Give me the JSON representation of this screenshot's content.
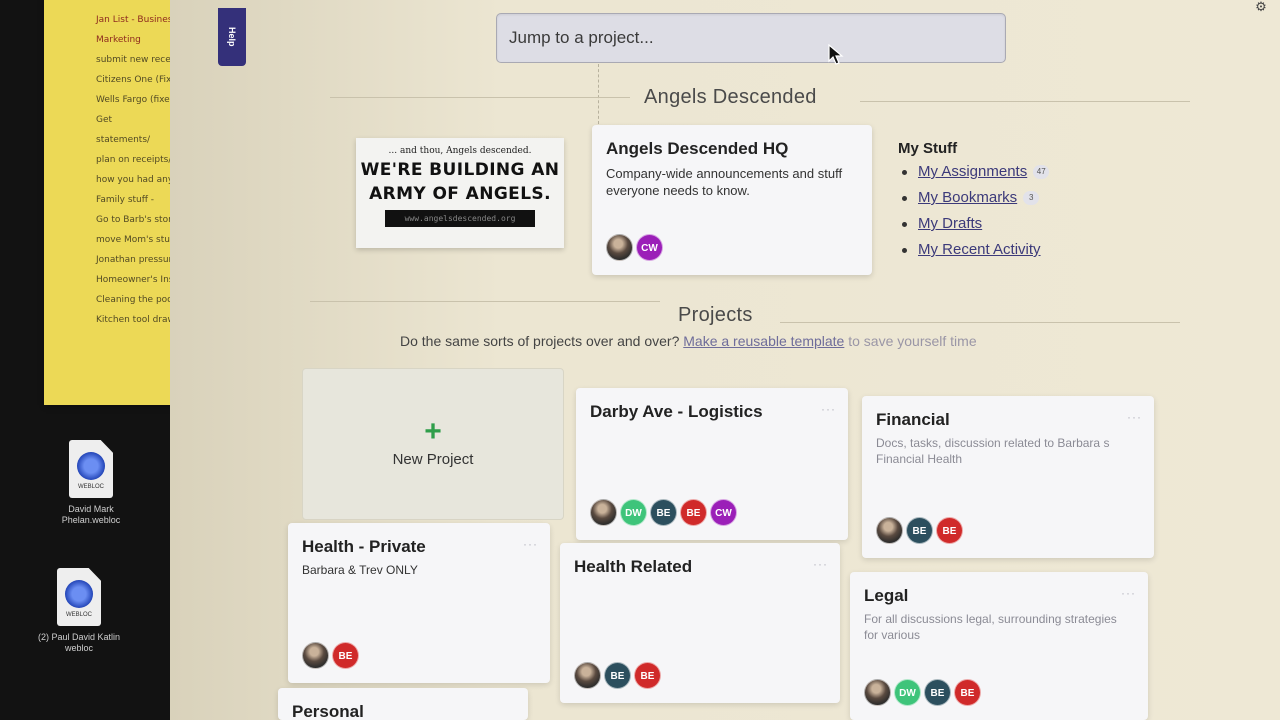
{
  "desktop": {
    "sticky_note_lines": [
      "Jan List - Business",
      "Marketing",
      "submit new receipts",
      "Citizens One (Fixed)",
      "Wells Fargo (fixed cost)",
      "Get",
      "statements/",
      "plan on receipts/fees",
      "how you had any ...",
      "Family stuff -",
      "Go to Barb's storage",
      "move Mom's stuff to st...",
      "Jonathan pressure ...",
      "Homeowner's Insurance",
      "Cleaning the pool",
      "Kitchen tool drawer"
    ],
    "icons": [
      {
        "label": "David Mark Phelan.webloc",
        "ext": "WEBLOC"
      },
      {
        "label": "(2) Paul David Katlin webloc",
        "ext": "WEBLOC"
      }
    ]
  },
  "app": {
    "help_label": "Help",
    "jump_placeholder": "Jump to a project...",
    "company_title": "Angels Descended",
    "poster": {
      "tagline": "... and thou, Angels descended.",
      "headline_1": "WE'RE BUILDING AN",
      "headline_2": "ARMY OF ANGELS.",
      "url": "www.angelsdescended.org"
    },
    "hq": {
      "title": "Angels Descended HQ",
      "description": "Company-wide announcements and stuff everyone needs to know.",
      "avatars": [
        {
          "initials": "",
          "color": "photo"
        },
        {
          "initials": "CW",
          "color": "#9b1fb8"
        }
      ]
    },
    "my_stuff": {
      "heading": "My Stuff",
      "links": [
        {
          "label": "My Assignments",
          "badge": "47"
        },
        {
          "label": "My Bookmarks",
          "badge": "3"
        },
        {
          "label": "My Drafts",
          "badge": ""
        },
        {
          "label": "My Recent Activity",
          "badge": ""
        }
      ]
    },
    "projects_title": "Projects",
    "projects_prompt": "Do the same sorts of projects over and over?",
    "projects_link": "Make a reusable template",
    "projects_suffix": " to save yourself time",
    "new_project_label": "New Project",
    "projects": [
      {
        "title": "Darby Ave - Logistics",
        "description": "",
        "avatars": [
          {
            "initials": "",
            "color": "photo"
          },
          {
            "initials": "DW",
            "color": "#3ec47a"
          },
          {
            "initials": "BE",
            "color": "#2c4f5e"
          },
          {
            "initials": "BE",
            "color": "#d02a2a"
          },
          {
            "initials": "CW",
            "color": "#9b1fb8"
          }
        ]
      },
      {
        "title": "Financial",
        "description": "Docs, tasks, discussion related to Barbara s Financial Health",
        "avatars": [
          {
            "initials": "",
            "color": "photo"
          },
          {
            "initials": "BE",
            "color": "#2c4f5e"
          },
          {
            "initials": "BE",
            "color": "#d02a2a"
          }
        ]
      },
      {
        "title": "Health - Private",
        "description": "Barbara & Trev ONLY",
        "avatars": [
          {
            "initials": "",
            "color": "photo"
          },
          {
            "initials": "BE",
            "color": "#d02a2a"
          }
        ]
      },
      {
        "title": "Health Related",
        "description": "",
        "avatars": [
          {
            "initials": "",
            "color": "photo"
          },
          {
            "initials": "BE",
            "color": "#2c4f5e"
          },
          {
            "initials": "BE",
            "color": "#d02a2a"
          }
        ]
      },
      {
        "title": "Legal",
        "description": "For all discussions legal, surrounding strategies for various",
        "avatars": [
          {
            "initials": "",
            "color": "photo"
          },
          {
            "initials": "DW",
            "color": "#3ec47a"
          },
          {
            "initials": "BE",
            "color": "#2c4f5e"
          },
          {
            "initials": "BE",
            "color": "#d02a2a"
          }
        ]
      },
      {
        "title": "Personal",
        "description": "",
        "avatars": []
      }
    ]
  }
}
